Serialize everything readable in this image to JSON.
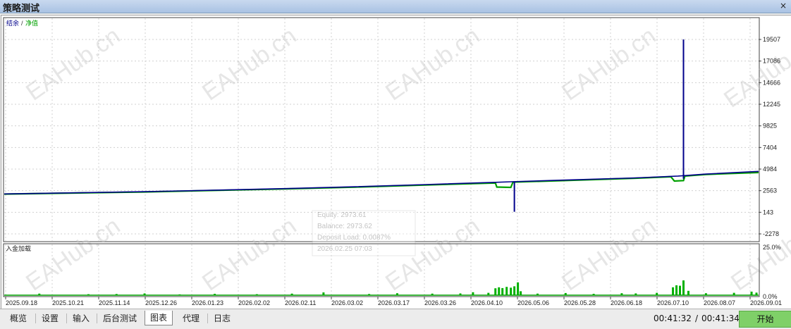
{
  "window": {
    "title": "策略测试",
    "close_glyph": "×"
  },
  "chart_data": [
    {
      "type": "line",
      "legend": {
        "balance_label": "结余",
        "separator": "/",
        "equity_label": "净值",
        "placement": "top-left"
      },
      "y_ticks": [
        "19507",
        "17086",
        "14666",
        "12245",
        "9825",
        "7404",
        "4984",
        "2563",
        "143",
        "-2278"
      ],
      "ylim": [
        -2278,
        19507
      ],
      "x_ticks": [
        "2025.09.18",
        "2025.10.21",
        "2025.11.14",
        "2025.12.26",
        "2026.01.23",
        "2026.02.02",
        "2026.02.11",
        "2026.03.02",
        "2026.03.17",
        "2026.03.26",
        "2026.04.10",
        "2026.05.06",
        "2026.05.28",
        "2026.06.18",
        "2026.07.10",
        "2026.08.07",
        "2026.09.01"
      ],
      "grid": true,
      "colors": {
        "balance": "#00008b",
        "equity": "#00a000",
        "grid": "#d0d0d0"
      },
      "series": [
        {
          "name": "结余",
          "points": [
            [
              0,
              2200
            ],
            [
              100,
              2320
            ],
            [
              200,
              2450
            ],
            [
              300,
              2620
            ],
            [
              400,
              2800
            ],
            [
              500,
              3000
            ],
            [
              600,
              3250
            ],
            [
              700,
              3500
            ],
            [
              722,
              3560
            ],
            [
              800,
              3750
            ],
            [
              900,
              4000
            ],
            [
              960,
              4200
            ],
            [
              1000,
              4420
            ],
            [
              1075,
              4720
            ]
          ]
        },
        {
          "name": "净值",
          "points": [
            [
              0,
              2180
            ],
            [
              100,
              2300
            ],
            [
              200,
              2420
            ],
            [
              300,
              2590
            ],
            [
              400,
              2760
            ],
            [
              500,
              2960
            ],
            [
              600,
              3200
            ],
            [
              700,
              3420
            ],
            [
              702,
              2970
            ],
            [
              722,
              2930
            ],
            [
              725,
              3520
            ],
            [
              800,
              3700
            ],
            [
              900,
              3960
            ],
            [
              950,
              4120
            ],
            [
              955,
              3640
            ],
            [
              968,
              3700
            ],
            [
              970,
              4200
            ],
            [
              1000,
              4380
            ],
            [
              1075,
              4600
            ]
          ]
        }
      ],
      "spikes": [
        {
          "name": "结余",
          "x": 727,
          "y_min": 200,
          "y_max": 3560
        },
        {
          "name": "结余",
          "x": 968,
          "y_min": 3900,
          "y_max": 19507
        }
      ],
      "tooltip": {
        "equity": "Equity: 2973.61",
        "balance": "Balance: 2973.62",
        "deposit_load": "Deposit Load: 0.0087%",
        "date": "2026.02.25 07:03"
      }
    },
    {
      "type": "bar",
      "label": "入金加载",
      "y_ticks": [
        "25.0%",
        "0.0%"
      ],
      "ylim": [
        0,
        25
      ],
      "bars": [
        [
          50,
          0.8
        ],
        [
          120,
          0.5
        ],
        [
          160,
          0.6
        ],
        [
          200,
          0.9
        ],
        [
          250,
          0.4
        ],
        [
          300,
          0.7
        ],
        [
          360,
          0.5
        ],
        [
          410,
          0.8
        ],
        [
          455,
          1.4
        ],
        [
          520,
          0.6
        ],
        [
          560,
          1.0
        ],
        [
          610,
          0.8
        ],
        [
          650,
          0.9
        ],
        [
          668,
          1.5
        ],
        [
          690,
          1.2
        ],
        [
          700,
          3.5
        ],
        [
          705,
          4.0
        ],
        [
          710,
          3.6
        ],
        [
          716,
          4.2
        ],
        [
          722,
          3.8
        ],
        [
          727,
          4.5
        ],
        [
          732,
          6.5
        ],
        [
          736,
          2.0
        ],
        [
          760,
          0.8
        ],
        [
          800,
          1.1
        ],
        [
          840,
          0.7
        ],
        [
          880,
          1.0
        ],
        [
          900,
          0.9
        ],
        [
          930,
          1.2
        ],
        [
          953,
          4.0
        ],
        [
          958,
          5.0
        ],
        [
          963,
          4.8
        ],
        [
          968,
          7.5
        ],
        [
          975,
          2.2
        ],
        [
          1000,
          1.0
        ],
        [
          1040,
          1.2
        ],
        [
          1065,
          1.8
        ],
        [
          1072,
          1.3
        ]
      ]
    }
  ],
  "watermark": "EAHub.cn",
  "tabs": [
    "概览",
    "设置",
    "输入",
    "后台测试",
    "图表",
    "代理",
    "日志"
  ],
  "active_tab": "图表",
  "status": {
    "elapsed": "00:41:32",
    "separator": "/",
    "total": "00:41:34"
  },
  "start_button": "开始"
}
